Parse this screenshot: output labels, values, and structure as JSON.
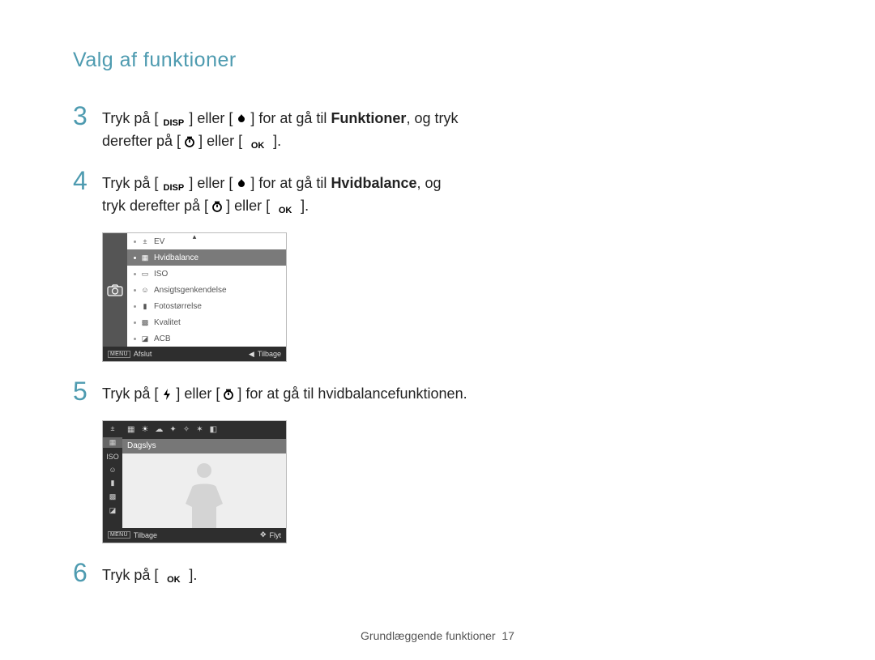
{
  "header": {
    "section_title": "Valg af funktioner"
  },
  "steps": {
    "s3": {
      "num": "3",
      "t1": "Tryk på [",
      "disp": "DISP",
      "t2": "] eller [",
      "t3": "] for at gå til ",
      "bold": "Funktioner",
      "t4": ", og tryk",
      "line2a": "derefter på [",
      "line2b": "] eller [",
      "ok": "OK",
      "line2c": "]."
    },
    "s4": {
      "num": "4",
      "t1": "Tryk på [",
      "disp": "DISP",
      "t2": "] eller [",
      "t3": "] for at gå til ",
      "bold": "Hvidbalance",
      "t4": ", og",
      "line2a": "tryk derefter på [",
      "line2b": "] eller [",
      "ok": "OK",
      "line2c": "]."
    },
    "s5": {
      "num": "5",
      "t1": "Tryk på [",
      "t2": "] eller [",
      "t3": "] for at gå til hvidbalancefunktionen."
    },
    "s6": {
      "num": "6",
      "t1": "Tryk på [",
      "ok": "OK",
      "t2": "]."
    }
  },
  "menu1": {
    "items": [
      {
        "glyph": "±",
        "label": "EV"
      },
      {
        "glyph": "▦",
        "label": "Hvidbalance"
      },
      {
        "glyph": "▭",
        "label": "ISO"
      },
      {
        "glyph": "☺",
        "label": "Ansigtsgenkendelse"
      },
      {
        "glyph": "▮",
        "label": "Fotostørrelse"
      },
      {
        "glyph": "▩",
        "label": "Kvalitet"
      },
      {
        "glyph": "◪",
        "label": "ACB"
      }
    ],
    "selected_index": 1,
    "footer": {
      "menu_tag": "MENU",
      "left": "Afslut",
      "arrow": "◀",
      "right": "Tilbage"
    }
  },
  "preview": {
    "sidebar_glyphs": [
      "±",
      "▦",
      "ISO",
      "☺",
      "▮",
      "▩",
      "◪"
    ],
    "sidebar_selected_index": 1,
    "wb_options": [
      "▦",
      "☀",
      "☁",
      "✦",
      "✧",
      "✶",
      "◧"
    ],
    "wb_selected_index": 1,
    "selected_label": "Dagslys",
    "footer": {
      "menu_tag": "MENU",
      "left": "Tilbage",
      "move_glyph": "✥",
      "right": "Flyt"
    }
  },
  "footer": {
    "text": "Grundlæggende funktioner",
    "page": "17"
  }
}
